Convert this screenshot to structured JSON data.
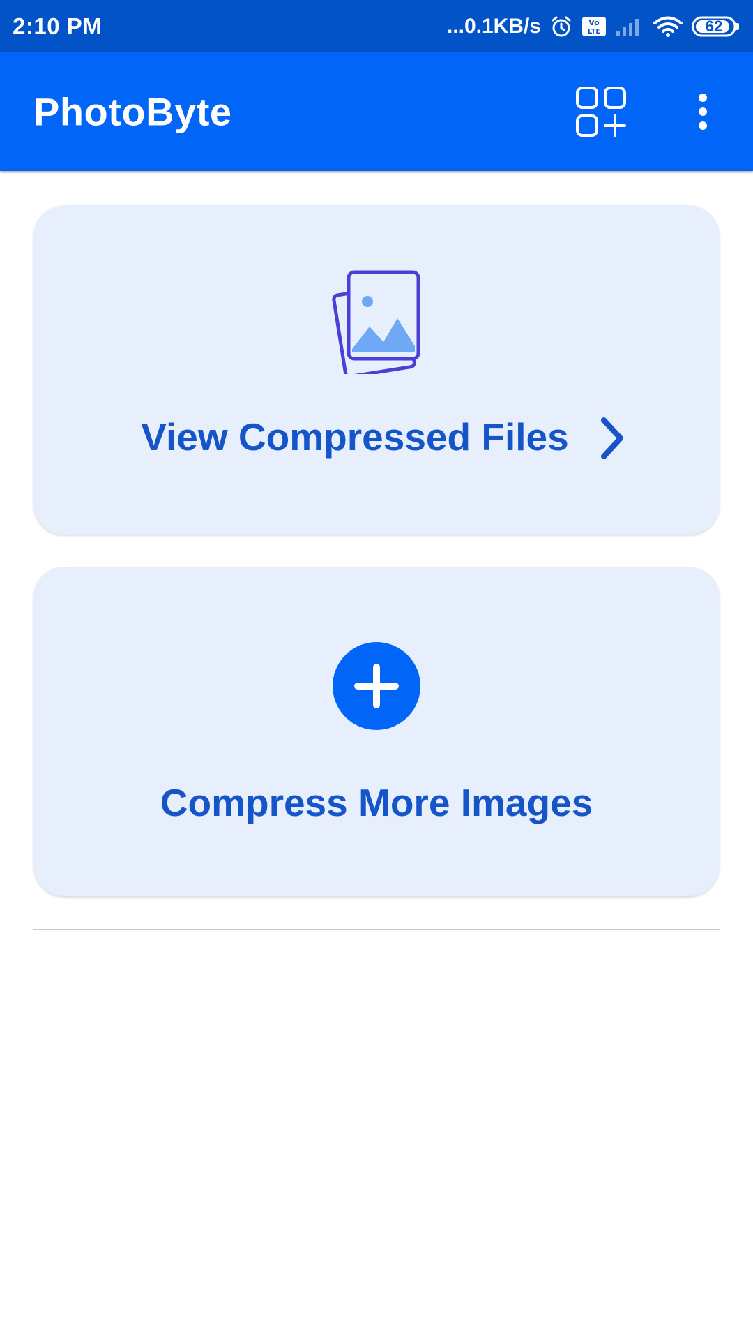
{
  "status_bar": {
    "time": "2:10 PM",
    "network_speed": "...0.1KB/s",
    "volte_label": "Vo LTE",
    "battery": "62",
    "icons": [
      "alarm-icon",
      "volte-icon",
      "signal-icon",
      "wifi-icon",
      "battery-icon"
    ]
  },
  "app_bar": {
    "title": "PhotoByte",
    "icons": [
      "apps-add-icon",
      "more-vert-icon"
    ]
  },
  "cards": {
    "view_files": {
      "label": "View Compressed Files",
      "icon": "photo-stack-icon"
    },
    "compress_more": {
      "label": "Compress More Images",
      "icon": "plus-circle-icon"
    }
  },
  "colors": {
    "status_bar": "#0253C7",
    "app_bar": "#0165F8",
    "card_bg": "#E7EFFD",
    "card_text": "#1555C8",
    "icon_purple": "#4B3FD6",
    "icon_light_blue": "#6FA8F5"
  }
}
